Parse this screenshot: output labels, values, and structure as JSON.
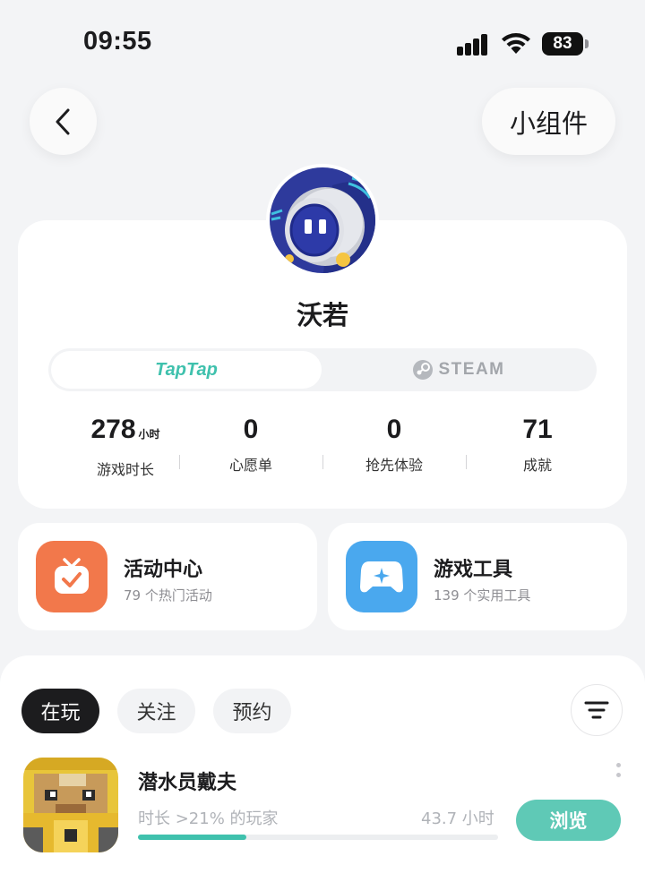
{
  "status_bar": {
    "time": "09:55",
    "battery": "83"
  },
  "header": {
    "widget_label": "小组件"
  },
  "profile": {
    "name": "沃若",
    "platforms": {
      "taptap": "TapTap",
      "steam": "STEAM"
    },
    "stats": [
      {
        "value": "278",
        "unit": "小时",
        "label": "游戏时长"
      },
      {
        "value": "0",
        "unit": "",
        "label": "心愿单"
      },
      {
        "value": "0",
        "unit": "",
        "label": "抢先体验"
      },
      {
        "value": "71",
        "unit": "",
        "label": "成就"
      }
    ]
  },
  "quick_cards": [
    {
      "title": "活动中心",
      "subtitle": "79 个热门活动",
      "icon": "tv-check-icon",
      "color": "#f2784b"
    },
    {
      "title": "游戏工具",
      "subtitle": "139 个实用工具",
      "icon": "gamepad-icon",
      "color": "#4aa8ee"
    }
  ],
  "list": {
    "tabs": [
      "在玩",
      "关注",
      "预约"
    ],
    "active_tab": "在玩",
    "games": [
      {
        "title": "潜水员戴夫",
        "stat_text": "时长 >21% 的玩家",
        "hours_text": "43.7 小时",
        "progress": 0.21,
        "button_label": "浏览"
      }
    ]
  },
  "colors": {
    "accent": "#3fc1ad",
    "background": "#f3f4f6"
  }
}
